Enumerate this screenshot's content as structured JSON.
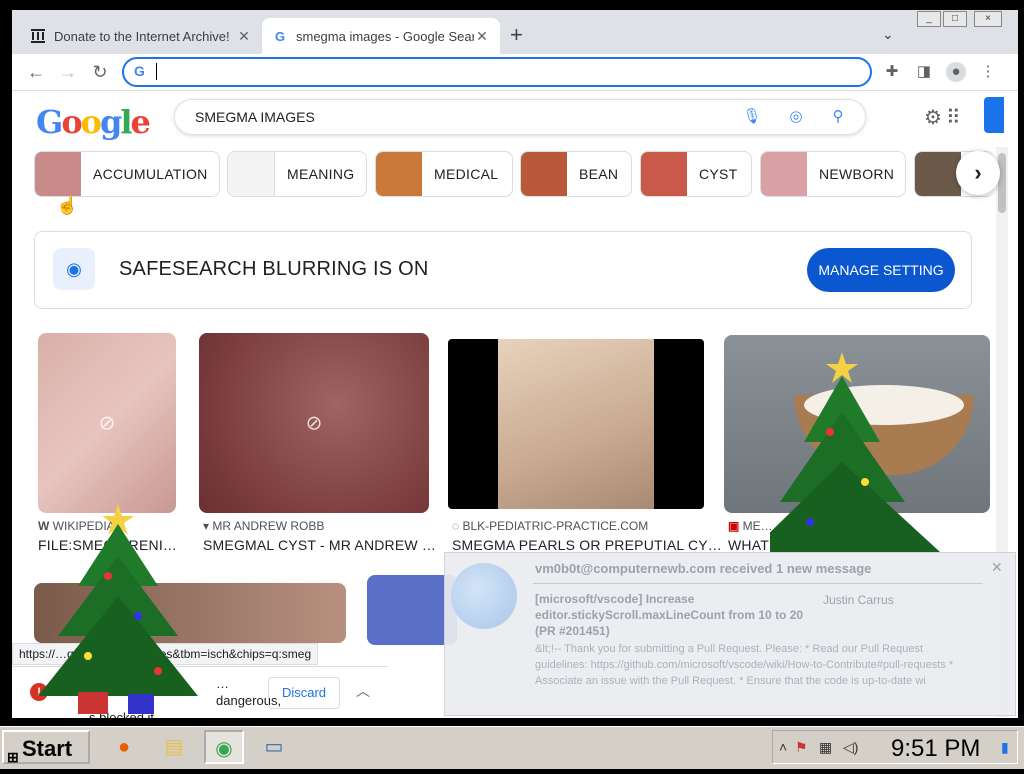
{
  "browser": {
    "tabs": [
      {
        "title": "Donate to the Internet Archive!",
        "active": false
      },
      {
        "title": "smegma images - Google Search",
        "active": true
      }
    ],
    "omnibox_value": "",
    "window_controls": [
      "_",
      "□",
      "×"
    ]
  },
  "google": {
    "logo_text": "Google",
    "query": "SMEGMA IMAGES",
    "chips": [
      {
        "label": "ACCUMULATION",
        "color": "#c98a8a"
      },
      {
        "label": "MEANING",
        "color": "#eeeeee"
      },
      {
        "label": "MEDICAL",
        "color": "#c97a3a"
      },
      {
        "label": "BEAN",
        "color": "#b85a3a"
      },
      {
        "label": "CYST",
        "color": "#c95a4a"
      },
      {
        "label": "NEWBORN",
        "color": "#d9a0a6"
      },
      {
        "label": "",
        "color": "#6b5a4a"
      }
    ],
    "safesearch": {
      "text": "SAFESEARCH BLURRING IS ON",
      "button": "MANAGE SETTING"
    },
    "results": [
      {
        "source": "WIKIPEDIA",
        "title": "FILE:SMEG…RENI…"
      },
      {
        "source": "MR ANDREW ROBB",
        "title": "SMEGMAL CYST - MR ANDREW …"
      },
      {
        "source": "BLK-PEDIATRIC-PRACTICE.COM",
        "title": "SMEGMA PEARLS OR PREPUTIAL CY…"
      },
      {
        "source": "ME…",
        "title": "WHAT…S HOW TO P…"
      }
    ],
    "status_url": "https://…q=smegma+images&tbm=isch&chips=q:smeg",
    "download": {
      "message_line1": "…dangerous,",
      "message_line2": "…s blocked it.",
      "discard": "Discard"
    }
  },
  "notification": {
    "header": "vm0b0t@computernewb.com received 1 new message",
    "subject": "[microsoft/vscode] Increase editor.stickyScroll.maxLineCount from 10 to 20 (PR #201451)",
    "from": "Justin Carrus",
    "body": "&lt;!-- Thank you for submitting a Pull Request. Please: * Read our Pull Request guidelines: https://github.com/microsoft/vscode/wiki/How-to-Contribute#pull-requests * Associate an issue with the Pull Request. * Ensure that the code is up-to-date wi"
  },
  "taskbar": {
    "start_label": "Start",
    "clock": "9:51 PM"
  }
}
